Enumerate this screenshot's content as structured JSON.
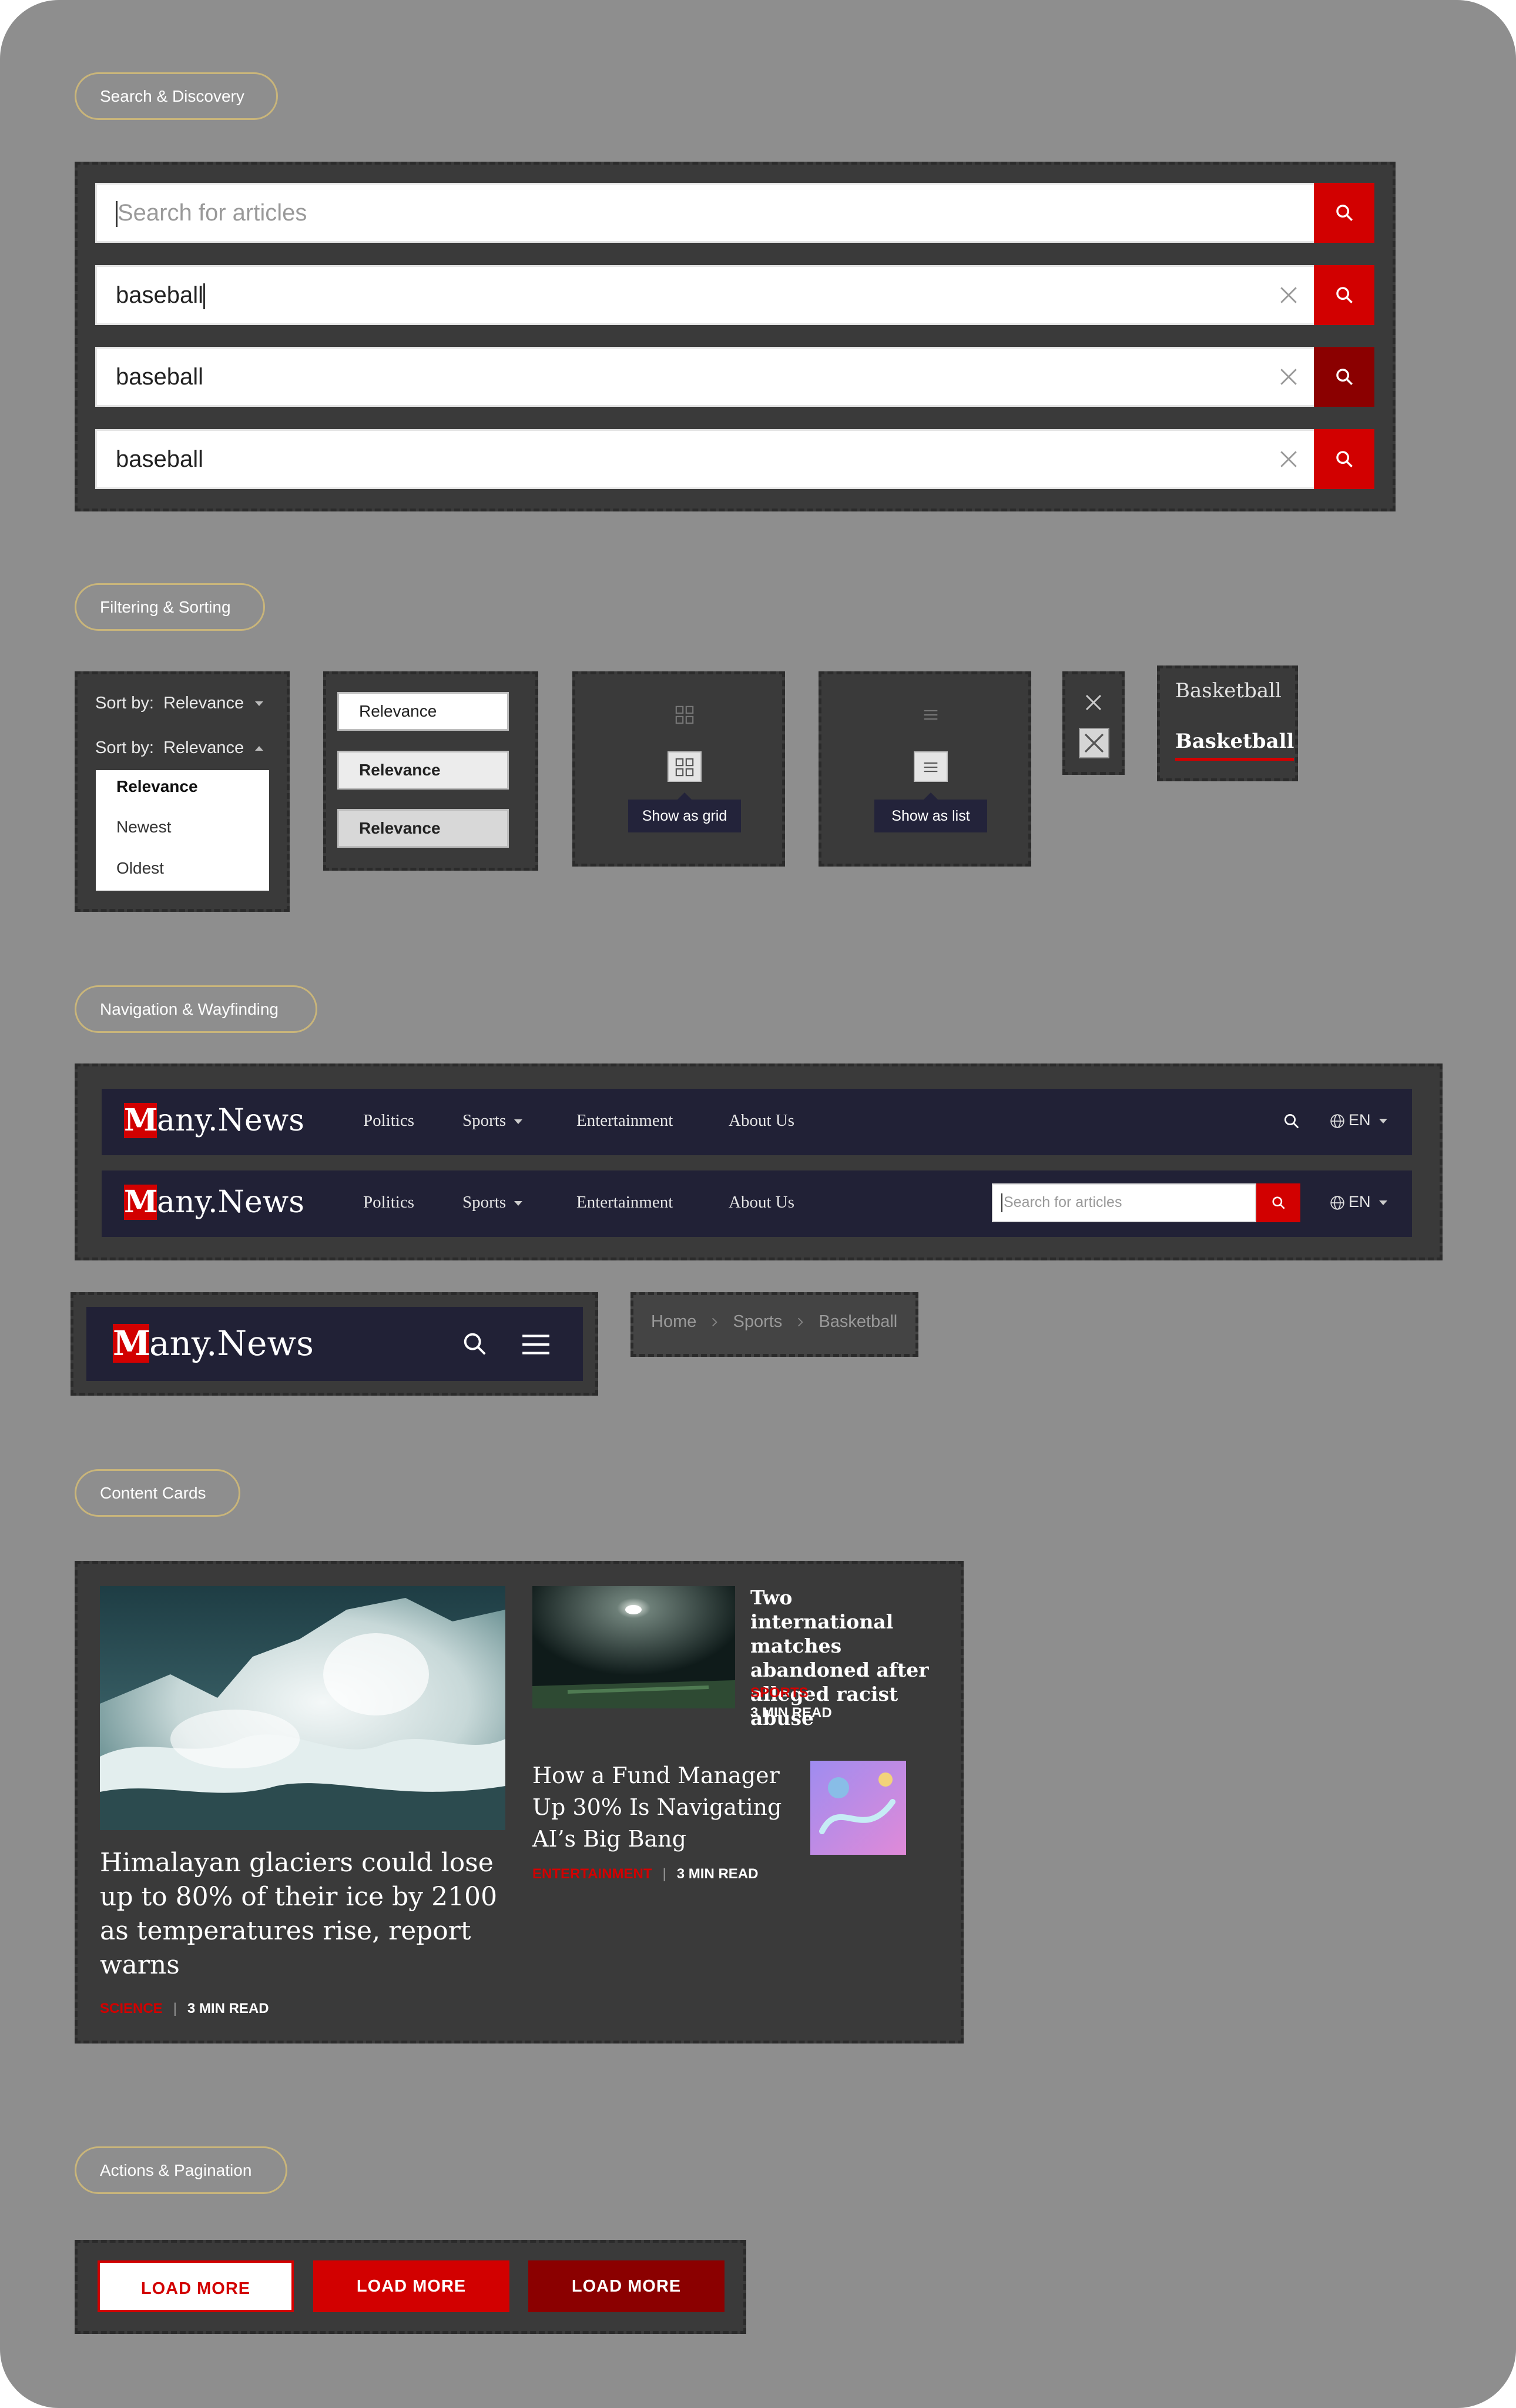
{
  "sections": {
    "search": "Search & Discovery",
    "filter": "Filtering & Sorting",
    "nav": "Navigation & Wayfinding",
    "cards": "Content Cards",
    "actions": "Actions & Pagination"
  },
  "search_rows": [
    {
      "state": "empty",
      "placeholder": "Search for articles"
    },
    {
      "state": "typing",
      "value": "baseball"
    },
    {
      "state": "pressed",
      "value": "baseball"
    },
    {
      "state": "default",
      "value": "baseball"
    }
  ],
  "sort": {
    "label": "Sort by:",
    "selected": "Relevance",
    "options": [
      "Relevance",
      "Newest",
      "Oldest"
    ]
  },
  "option_states": [
    "Relevance",
    "Relevance",
    "Relevance"
  ],
  "view_toggles": {
    "grid_tooltip": "Show as grid",
    "list_tooltip": "Show as list"
  },
  "tabs": {
    "inactive": "Basketball",
    "active": "Basketball"
  },
  "navbar": {
    "logo_initial": "M",
    "logo_rest": "any.News",
    "links": [
      "Politics",
      "Sports",
      "Entertainment",
      "About Us"
    ],
    "language": "EN",
    "search_placeholder": "Search for articles"
  },
  "breadcrumb": [
    "Home",
    "Sports",
    "Basketball"
  ],
  "cards": {
    "main": {
      "title": "Himalayan glaciers could lose up to 80% of their ice by 2100 as temperatures rise, report warns",
      "category": "SCIENCE",
      "read_time": "3 MIN READ"
    },
    "side1": {
      "title": "Two international matches abandoned after alleged racist abuse",
      "category": "SPORTS",
      "read_time": "3 MIN READ"
    },
    "side2": {
      "title": "How a Fund Manager Up 30% Is Navigating AI’s Big Bang",
      "category": "ENTERTAINMENT",
      "read_time": "3 MIN READ"
    }
  },
  "load_more": [
    "LOAD MORE",
    "LOAD MORE",
    "LOAD MORE"
  ],
  "colors": {
    "accent": "#d20000",
    "accent_dark": "#8b0000",
    "navy": "#212136",
    "panel": "#3a3a3a",
    "page": "#8e8e8e"
  }
}
